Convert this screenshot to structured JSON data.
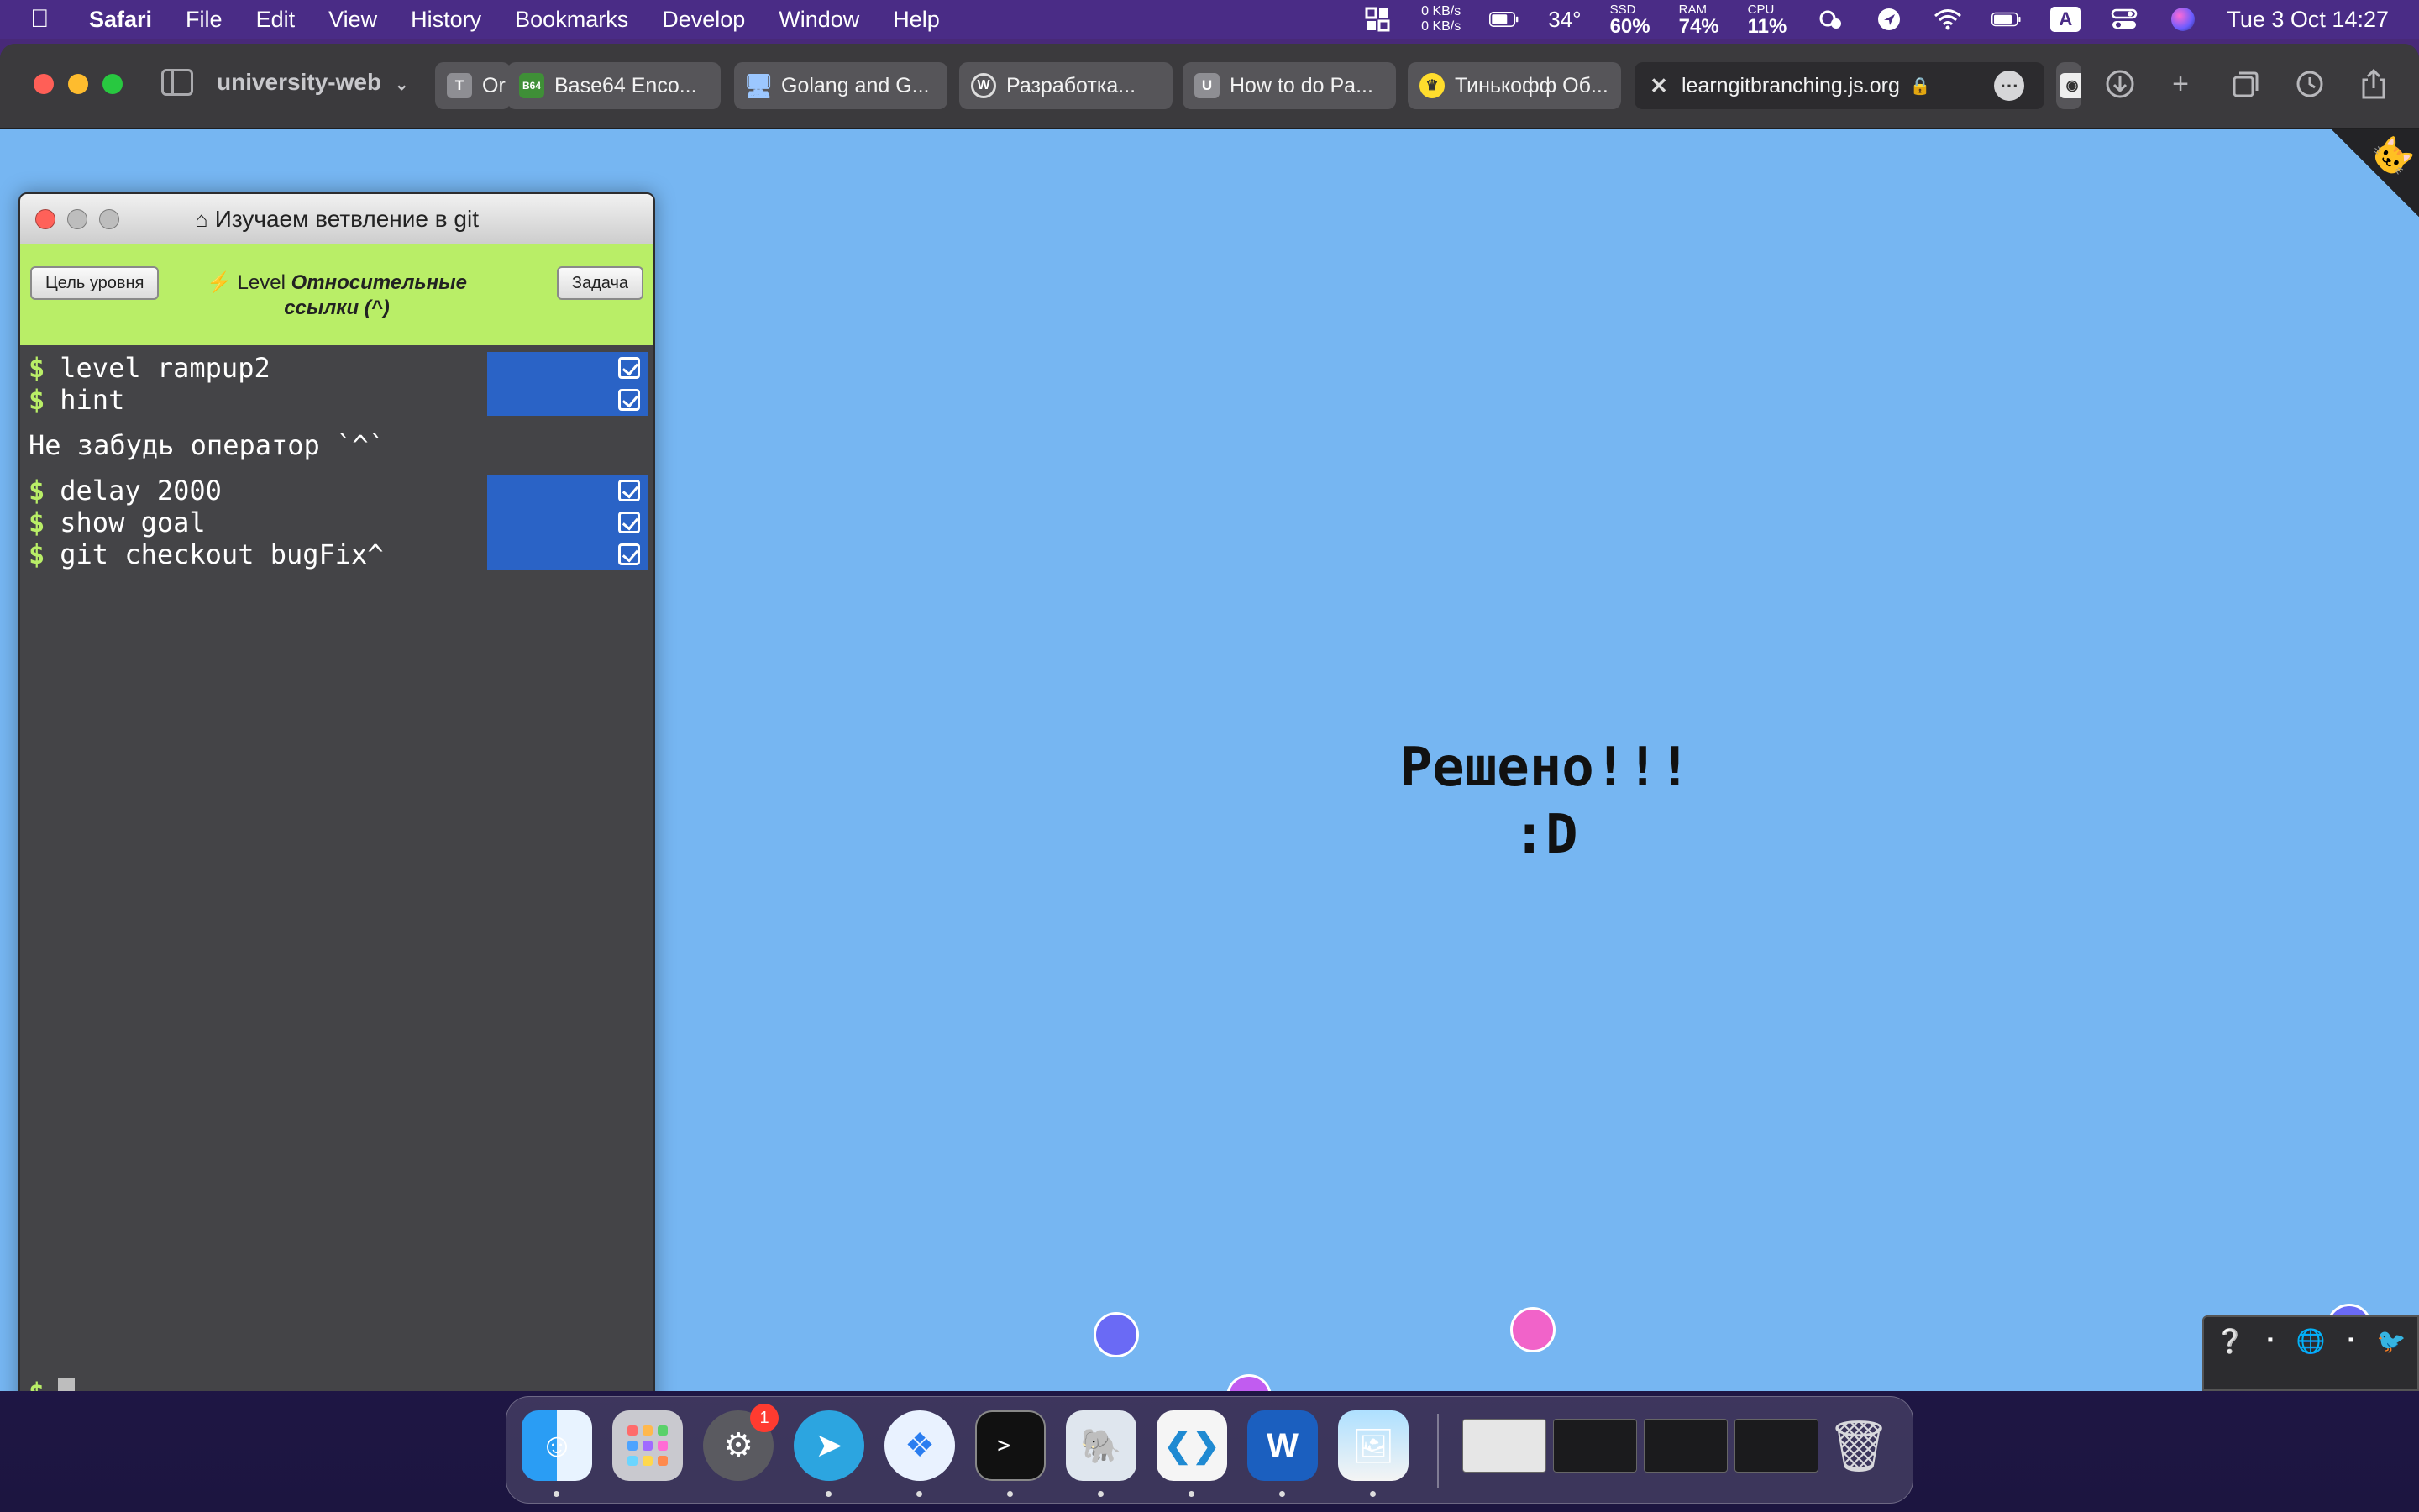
{
  "menubar": {
    "app_name": "Safari",
    "menus": [
      "File",
      "Edit",
      "View",
      "History",
      "Bookmarks",
      "Develop",
      "Window",
      "Help"
    ],
    "net_up": "0 KB/s",
    "net_down": "0 KB/s",
    "temp": "34°",
    "ssd_label": "SSD",
    "ssd_value": "60%",
    "ram_label": "RAM",
    "ram_value": "74%",
    "cpu_label": "CPU",
    "cpu_value": "11%",
    "input_source": "A",
    "datetime": "Tue 3 Oct  14:27"
  },
  "browser": {
    "tab_group": "university-web",
    "tabs": [
      {
        "favicon": "T",
        "label": "Or"
      },
      {
        "favicon": "B64",
        "label": "Base64 Enco..."
      },
      {
        "favicon": "monitor-icon",
        "label": "Golang and G..."
      },
      {
        "favicon": "W",
        "label": "Разработка..."
      },
      {
        "favicon": "U",
        "label": "How to do Pa..."
      },
      {
        "favicon": "tinkoff-icon",
        "label": "Тинькофф Об..."
      },
      {
        "favicon": "close-icon",
        "label": "learngitbranching.js.org"
      }
    ]
  },
  "game": {
    "window_title": "Изучаем ветвление в git",
    "level_goal_button": "Цель уровня",
    "objective_button": "Задача",
    "level_prefix": "Level",
    "level_name": "Относительные ссылки (^)",
    "commands": [
      {
        "text": "level rampup2"
      },
      {
        "text": "hint"
      }
    ],
    "hint_output": "Не забудь оператор `^`",
    "commands_after": [
      {
        "text": "delay 2000"
      },
      {
        "text": "show goal"
      },
      {
        "text": "git checkout bugFix^"
      }
    ],
    "prompt": "$",
    "solved_line1": "Решено!!!",
    "solved_line2": ":D",
    "colors": {
      "canvas": "#76b6f2",
      "level_bar": "#b9ee67",
      "status_cell": "#2a63c6",
      "node_blue": "#6a6af5",
      "node_purple": "#c15cf0",
      "node_pink": "#f163c9"
    }
  },
  "dock": {
    "apps": [
      "finder-icon",
      "launchpad-icon",
      "system-settings-icon",
      "telegram-icon",
      "safari-icon",
      "terminal-icon",
      "postgres-icon",
      "vscode-icon",
      "word-icon",
      "preview-icon"
    ],
    "settings_badge": "1"
  }
}
